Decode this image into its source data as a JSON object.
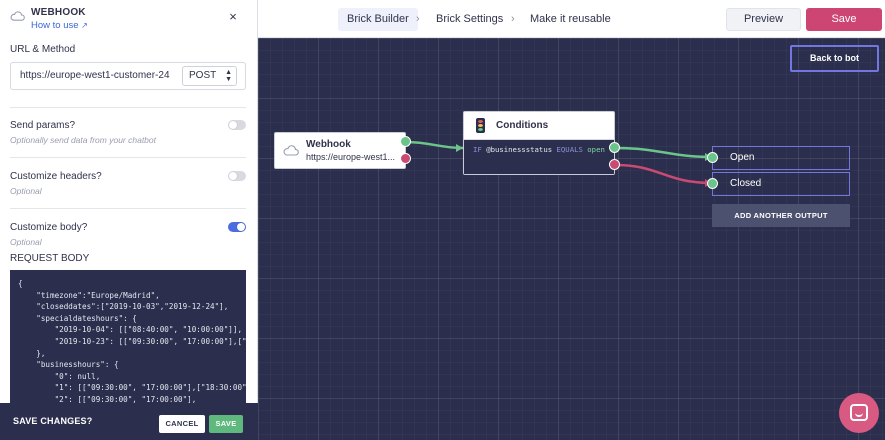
{
  "topbar": {
    "crumbs": [
      "Brick Builder",
      "Brick Settings",
      "Make it reusable"
    ],
    "separators": [
      "›",
      "›"
    ],
    "preview_label": "Preview",
    "save_label": "Save"
  },
  "panel": {
    "title": "WEBHOOK",
    "howto_label": "How to use",
    "close_icon": "×",
    "url_method": {
      "label": "URL & Method",
      "url": "https://europe-west1-customer-24",
      "method": "POST"
    },
    "send_params": {
      "label": "Send params?",
      "sub": "Optionally send data from your chatbot",
      "enabled": false
    },
    "custom_headers": {
      "label": "Customize headers?",
      "sub": "Optional",
      "enabled": false
    },
    "custom_body": {
      "label": "Customize body?",
      "sub": "Optional",
      "enabled": true
    },
    "request_body_label": "REQUEST BODY",
    "request_body": "{\n    \"timezone\":\"Europe/Madrid\",\n    \"closeddates\":[\"2019-10-03\",\"2019-12-24\"],\n    \"specialdateshours\": {\n        \"2019-10-04\": [[\"08:40:00\", \"10:00:00\"]],\n        \"2019-10-23\": [[\"09:30:00\", \"17:00:00\"],[\"18:3\n    },\n    \"businesshours\": {\n        \"0\": null,\n        \"1\": [[\"09:30:00\", \"17:00:00\"],[\"18:30:00\", \"\n        \"2\": [[\"09:30:00\", \"17:00:00\"],",
    "savebar": {
      "label": "SAVE CHANGES?",
      "cancel_label": "CANCEL",
      "save_label": "SAVE"
    }
  },
  "canvas": {
    "back_label": "Back to bot",
    "webhook_node": {
      "title": "Webhook",
      "url": "https://europe-west1..."
    },
    "conditions_node": {
      "title": "Conditions",
      "rule": {
        "if": "IF",
        "variable": "@businessstatus",
        "op": "EQUALS",
        "value": "open"
      }
    },
    "outputs": [
      "Open",
      "Closed"
    ],
    "add_output_label": "ADD ANOTHER OUTPUT"
  },
  "colors": {
    "canvas_bg": "#2b2e4c",
    "accent": "#cc4573",
    "success": "#6bc58a",
    "error": "#c94a72",
    "outline": "#7277e0"
  }
}
